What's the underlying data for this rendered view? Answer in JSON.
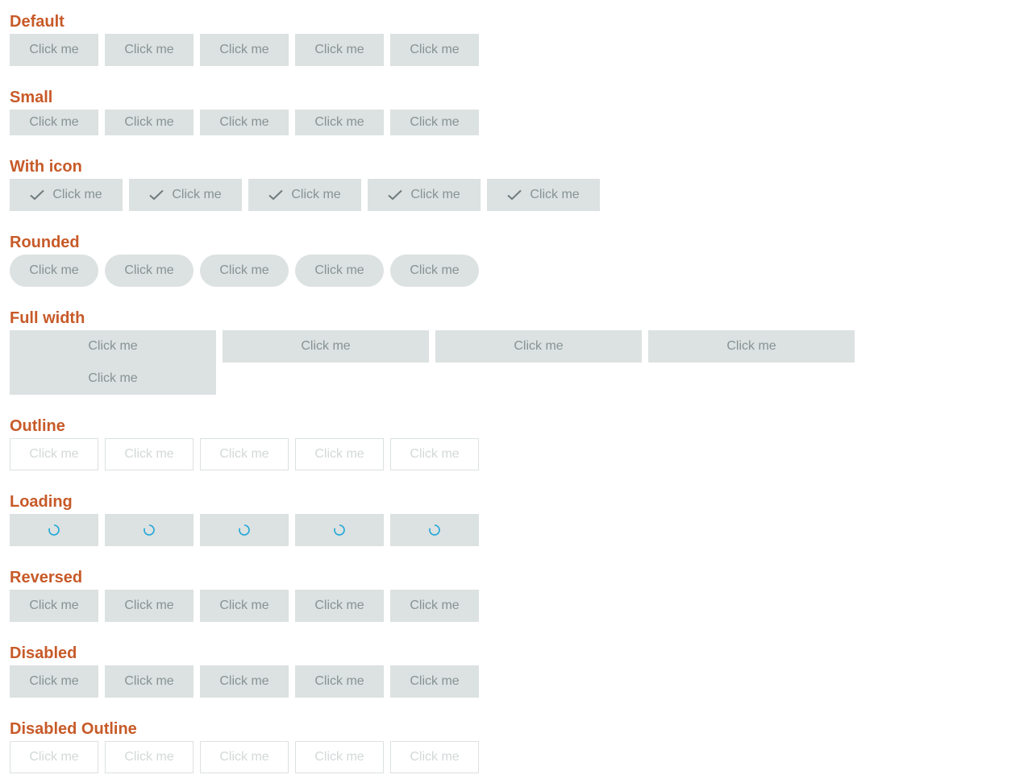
{
  "colors": {
    "heading": "#c75a28",
    "button_bg": "#dce1e1",
    "button_text": "#879393",
    "outline_text": "#d3d8d8",
    "spinner": "#1ea7d8"
  },
  "sections": {
    "default": {
      "title": "Default",
      "buttons": [
        "Click me",
        "Click me",
        "Click me",
        "Click me",
        "Click me"
      ]
    },
    "small": {
      "title": "Small",
      "buttons": [
        "Click me",
        "Click me",
        "Click me",
        "Click me",
        "Click me"
      ]
    },
    "with_icon": {
      "title": "With icon",
      "icon": "check-icon",
      "buttons": [
        "Click me",
        "Click me",
        "Click me",
        "Click me",
        "Click me"
      ]
    },
    "rounded": {
      "title": "Rounded",
      "buttons": [
        "Click me",
        "Click me",
        "Click me",
        "Click me",
        "Click me"
      ]
    },
    "full_width": {
      "title": "Full width",
      "first_button_lines": [
        "Click me",
        "Click me"
      ],
      "buttons": [
        "Click me",
        "Click me",
        "Click me"
      ]
    },
    "outline": {
      "title": "Outline",
      "buttons": [
        "Click me",
        "Click me",
        "Click me",
        "Click me",
        "Click me"
      ]
    },
    "loading": {
      "title": "Loading",
      "icon": "spinner-icon",
      "count": 5
    },
    "reversed": {
      "title": "Reversed",
      "buttons": [
        "Click me",
        "Click me",
        "Click me",
        "Click me",
        "Click me"
      ]
    },
    "disabled": {
      "title": "Disabled",
      "buttons": [
        "Click me",
        "Click me",
        "Click me",
        "Click me",
        "Click me"
      ]
    },
    "disabled_outline": {
      "title": "Disabled Outline",
      "buttons": [
        "Click me",
        "Click me",
        "Click me",
        "Click me",
        "Click me"
      ]
    }
  }
}
